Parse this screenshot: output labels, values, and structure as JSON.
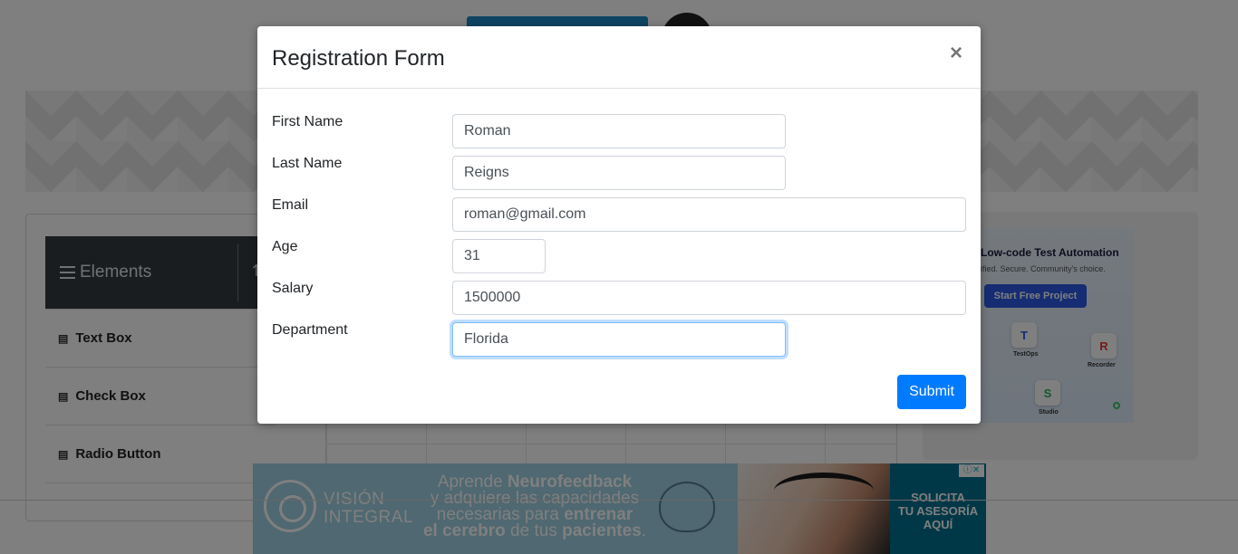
{
  "background": {
    "sidebar": {
      "header_label": "Elements",
      "header_arrow": "⇅",
      "items": [
        {
          "label": "Text Box",
          "icon": "doc-icon"
        },
        {
          "label": "Check Box",
          "icon": "doc-icon"
        },
        {
          "label": "Radio Button",
          "icon": "doc-icon"
        }
      ]
    },
    "ad_right": {
      "heading": "Low-code Test Automation",
      "sub": "ified. Secure. Community's choice.",
      "button": "Start Free Project",
      "tiles": [
        {
          "letter": "T",
          "caption": "TestOps",
          "color": "#2c5be6"
        },
        {
          "letter": "R",
          "caption": "Recorder",
          "color": "#e53935"
        },
        {
          "letter": "S",
          "caption": "Studio",
          "color": "#27ae60"
        }
      ]
    },
    "ad_bottom": {
      "brand_line1": "VISIÓN",
      "brand_line2": "INTEGRAL",
      "copy_line1_pre": "Aprende ",
      "copy_line1_bold": "Neurofeedback",
      "copy_line2": "y adquiere las capacidades",
      "copy_line3_pre": "necesarias  para ",
      "copy_line3_bold": "entrenar",
      "copy_line4_bold1": "el cerebro",
      "copy_line4_mid": " de tus ",
      "copy_line4_bold2": "pacientes",
      "copy_line4_end": ".",
      "cta_line1": "SOLICITA",
      "cta_line2": "TU ASESORÍA",
      "cta_line3": "AQUÍ",
      "badge": "ⓘ✕"
    }
  },
  "modal": {
    "title": "Registration Form",
    "close_label": "×",
    "fields": {
      "first_name": {
        "label": "First Name",
        "value": "Roman"
      },
      "last_name": {
        "label": "Last Name",
        "value": "Reigns"
      },
      "email": {
        "label": "Email",
        "value": "roman@gmail.com"
      },
      "age": {
        "label": "Age",
        "value": "31"
      },
      "salary": {
        "label": "Salary",
        "value": "1500000"
      },
      "department": {
        "label": "Department",
        "value": "Florida"
      }
    },
    "submit_label": "Submit"
  },
  "colors": {
    "primary": "#007bff",
    "sidebar_header": "#343a40",
    "backdrop": "rgba(0,0,0,0.5)"
  }
}
